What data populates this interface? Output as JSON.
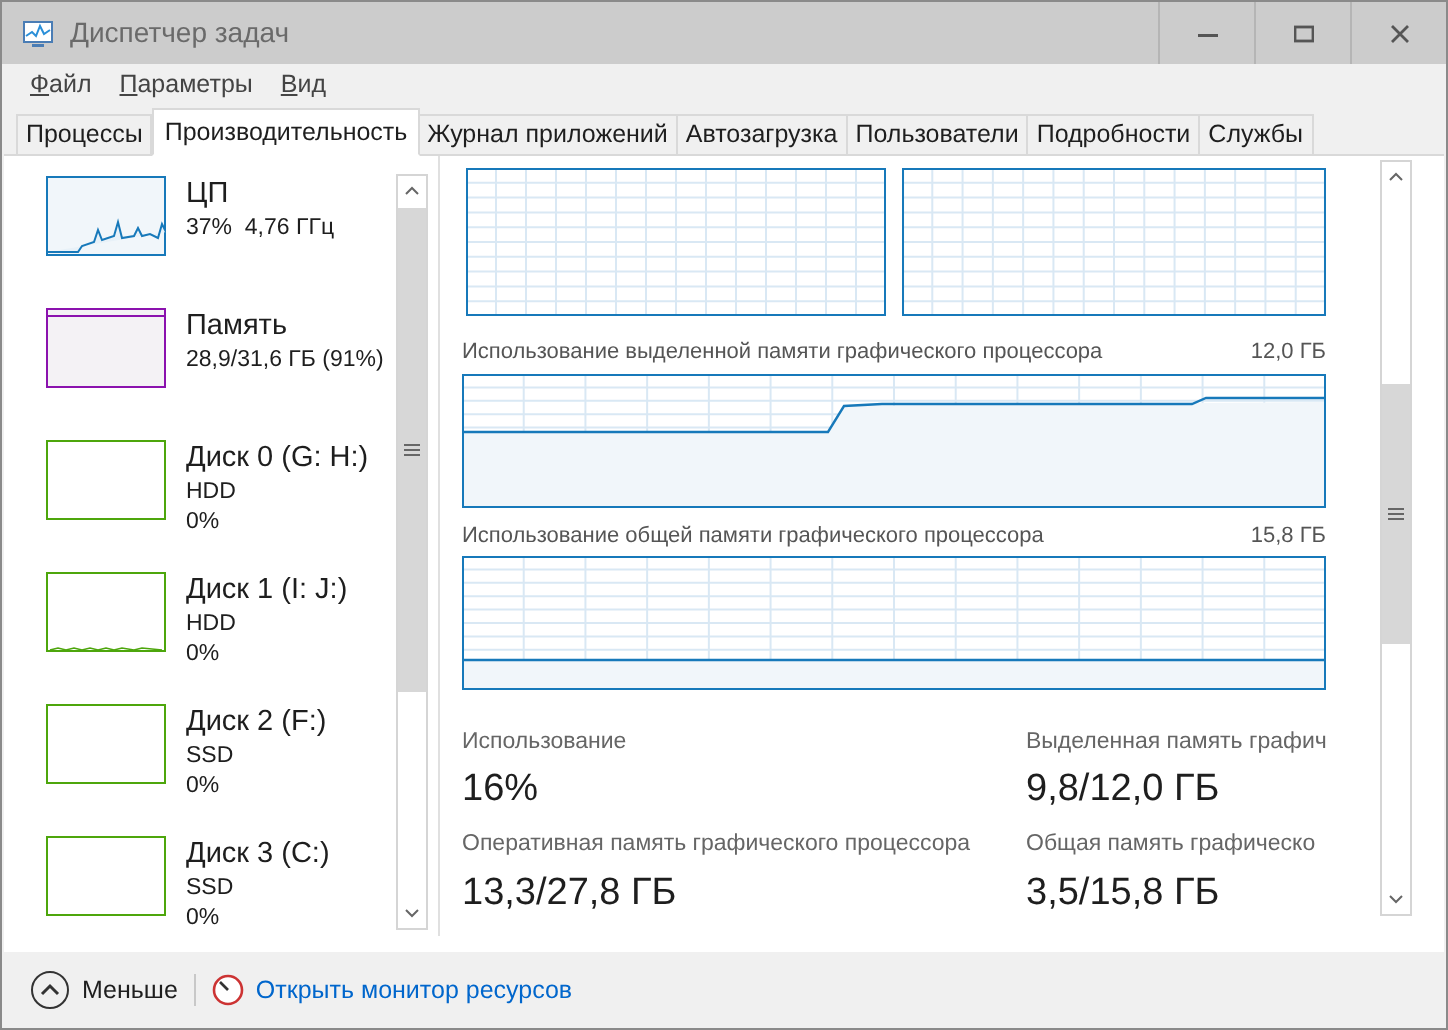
{
  "window": {
    "title": "Диспетчер задач"
  },
  "menu": [
    {
      "label": "Файл"
    },
    {
      "label": "Параметры"
    },
    {
      "label": "Вид"
    }
  ],
  "tabs": [
    {
      "label": "Процессы",
      "selected": false
    },
    {
      "label": "Производительность",
      "selected": true
    },
    {
      "label": "Журнал приложений",
      "selected": false
    },
    {
      "label": "Автозагрузка",
      "selected": false
    },
    {
      "label": "Пользователи",
      "selected": false
    },
    {
      "label": "Подробности",
      "selected": false
    },
    {
      "label": "Службы",
      "selected": false
    }
  ],
  "sidebar": {
    "items": [
      {
        "kind": "cpu",
        "name": "ЦП",
        "detail": "37%  4,76 ГГц"
      },
      {
        "kind": "memory",
        "name": "Память",
        "detail": "28,9/31,6 ГБ (91%)"
      },
      {
        "kind": "disk",
        "name": "Диск 0 (G: H:)",
        "type": "HDD",
        "detail": "0%"
      },
      {
        "kind": "disk",
        "name": "Диск 1 (I: J:)",
        "type": "HDD",
        "detail": "0%"
      },
      {
        "kind": "disk",
        "name": "Диск 2 (F:)",
        "type": "SSD",
        "detail": "0%"
      },
      {
        "kind": "disk",
        "name": "Диск 3 (C:)",
        "type": "SSD",
        "detail": "0%"
      }
    ]
  },
  "memory_graphs": [
    {
      "title": "Использование выделенной памяти графического процессора",
      "max": "12,0 ГБ"
    },
    {
      "title": "Использование общей памяти графического процессора",
      "max": "15,8 ГБ"
    }
  ],
  "stats": [
    {
      "label": "Использование",
      "value": "16%"
    },
    {
      "label": "Выделенная память графич",
      "value": "9,8/12,0 ГБ"
    },
    {
      "label": "Оперативная память графического процессора",
      "value": "13,3/27,8 ГБ"
    },
    {
      "label": "Общая память графическо",
      "value": "3,5/15,8 ГБ"
    }
  ],
  "footer": {
    "less": "Меньше",
    "link": "Открыть монитор ресурсов"
  }
}
